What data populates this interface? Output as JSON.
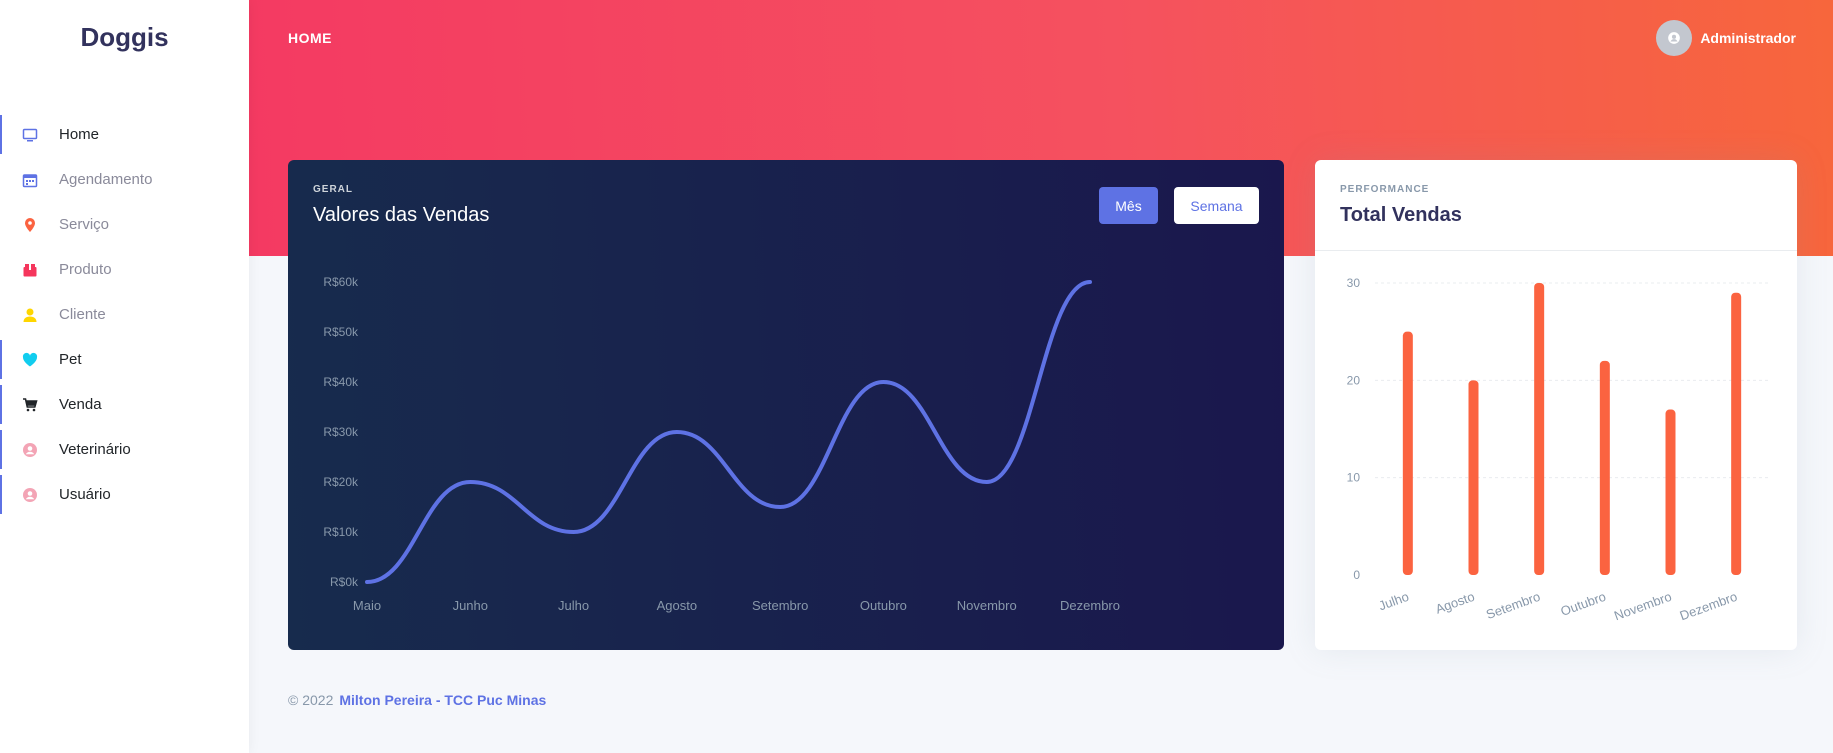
{
  "brand": "Doggis",
  "sidebar": {
    "items": [
      {
        "label": "Home",
        "icon": "monitor-icon",
        "color": "#5e72e4",
        "active": true
      },
      {
        "label": "Agendamento",
        "icon": "calendar-icon",
        "color": "#5e72e4",
        "active": false
      },
      {
        "label": "Serviço",
        "icon": "map-pin-icon",
        "color": "#fb6340",
        "active": false
      },
      {
        "label": "Produto",
        "icon": "box-icon",
        "color": "#f5365c",
        "active": false
      },
      {
        "label": "Cliente",
        "icon": "user-icon",
        "color": "#ffd600",
        "active": false
      },
      {
        "label": "Pet",
        "icon": "heart-icon",
        "color": "#11cdef",
        "active": true
      },
      {
        "label": "Venda",
        "icon": "cart-icon",
        "color": "#212529",
        "active": true
      },
      {
        "label": "Veterinário",
        "icon": "user-circle-icon",
        "color": "#f3a4b5",
        "active": true
      },
      {
        "label": "Usuário",
        "icon": "user-circle-icon",
        "color": "#f3a4b5",
        "active": true
      }
    ]
  },
  "header": {
    "breadcrumb": "HOME",
    "user_name": "Administrador"
  },
  "sales_card": {
    "eyebrow": "GERAL",
    "title": "Valores das Vendas",
    "toggle_month": "Mês",
    "toggle_week": "Semana"
  },
  "performance_card": {
    "eyebrow": "PERFORMANCE",
    "title": "Total Vendas"
  },
  "footer": {
    "copyright": "© 2022",
    "link": "Milton Pereira - TCC Puc Minas"
  },
  "colors": {
    "accent": "#5e72e4",
    "bar": "#fb6340",
    "line": "#5e72e4"
  },
  "chart_data": [
    {
      "type": "line",
      "x": [
        "Maio",
        "Junho",
        "Julho",
        "Agosto",
        "Setembro",
        "Outubro",
        "Novembro",
        "Dezembro"
      ],
      "values": [
        0,
        20,
        10,
        30,
        15,
        40,
        20,
        60
      ],
      "ytick_labels": [
        "R$0k",
        "R$10k",
        "R$20k",
        "R$30k",
        "R$40k",
        "R$50k",
        "R$60k"
      ],
      "ylim": [
        0,
        60
      ],
      "grid": false
    },
    {
      "type": "bar",
      "categories": [
        "Julho",
        "Agosto",
        "Setembro",
        "Outubro",
        "Novembro",
        "Dezembro"
      ],
      "values": [
        25,
        20,
        30,
        22,
        17,
        29
      ],
      "yticks": [
        0,
        10,
        20,
        30
      ],
      "ylim": [
        0,
        30
      ],
      "grid": true
    }
  ]
}
